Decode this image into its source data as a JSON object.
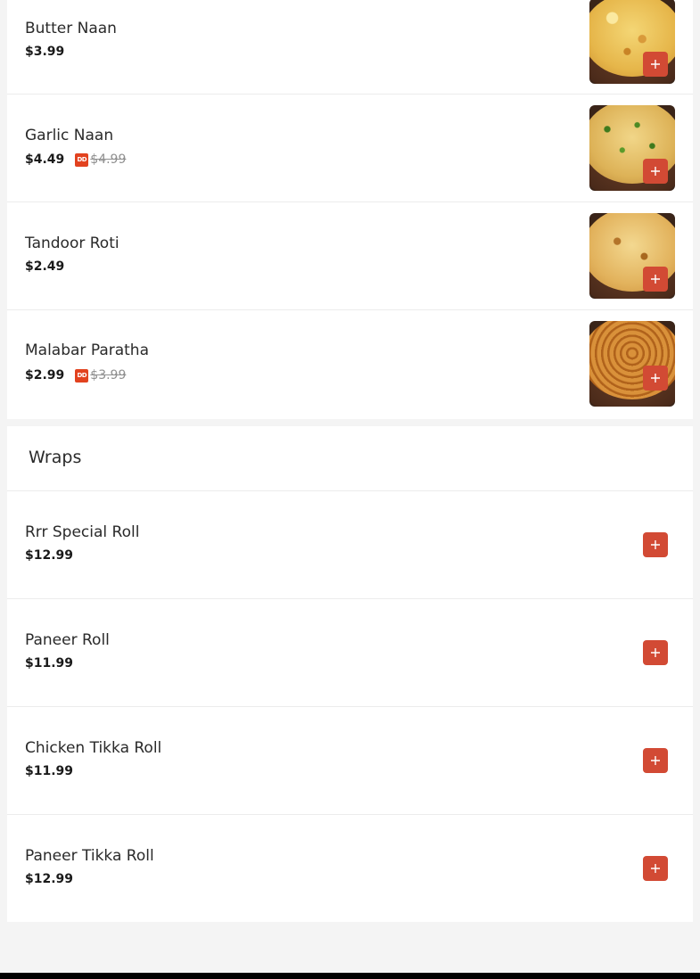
{
  "breads": [
    {
      "name": "Butter Naan",
      "price": "$3.99",
      "image": "butter-naan-photo",
      "add_icon": "plus-icon"
    },
    {
      "name": "Garlic Naan",
      "price": "$4.49",
      "deal_icon": "deal-badge-icon",
      "deal_icon_text": "DD",
      "original_price": "$4.99",
      "image": "garlic-naan-photo",
      "add_icon": "plus-icon"
    },
    {
      "name": "Tandoor Roti",
      "price": "$2.49",
      "image": "tandoor-roti-photo",
      "add_icon": "plus-icon"
    },
    {
      "name": "Malabar Paratha",
      "price": "$2.99",
      "deal_icon": "deal-badge-icon",
      "deal_icon_text": "DD",
      "original_price": "$3.99",
      "image": "malabar-paratha-photo",
      "add_icon": "plus-icon"
    }
  ],
  "wraps": {
    "title": "Wraps",
    "items": [
      {
        "name": "Rrr Special Roll",
        "price": "$12.99",
        "add_icon": "plus-icon"
      },
      {
        "name": "Paneer Roll",
        "price": "$11.99",
        "add_icon": "plus-icon"
      },
      {
        "name": "Chicken Tikka Roll",
        "price": "$11.99",
        "add_icon": "plus-icon"
      },
      {
        "name": "Paneer Tikka Roll",
        "price": "$12.99",
        "add_icon": "plus-icon"
      }
    ]
  },
  "colors": {
    "add_button": "#d24a34",
    "deal_badge": "#e2421f",
    "page_background": "#f4f4f4",
    "card_background": "#ffffff"
  }
}
